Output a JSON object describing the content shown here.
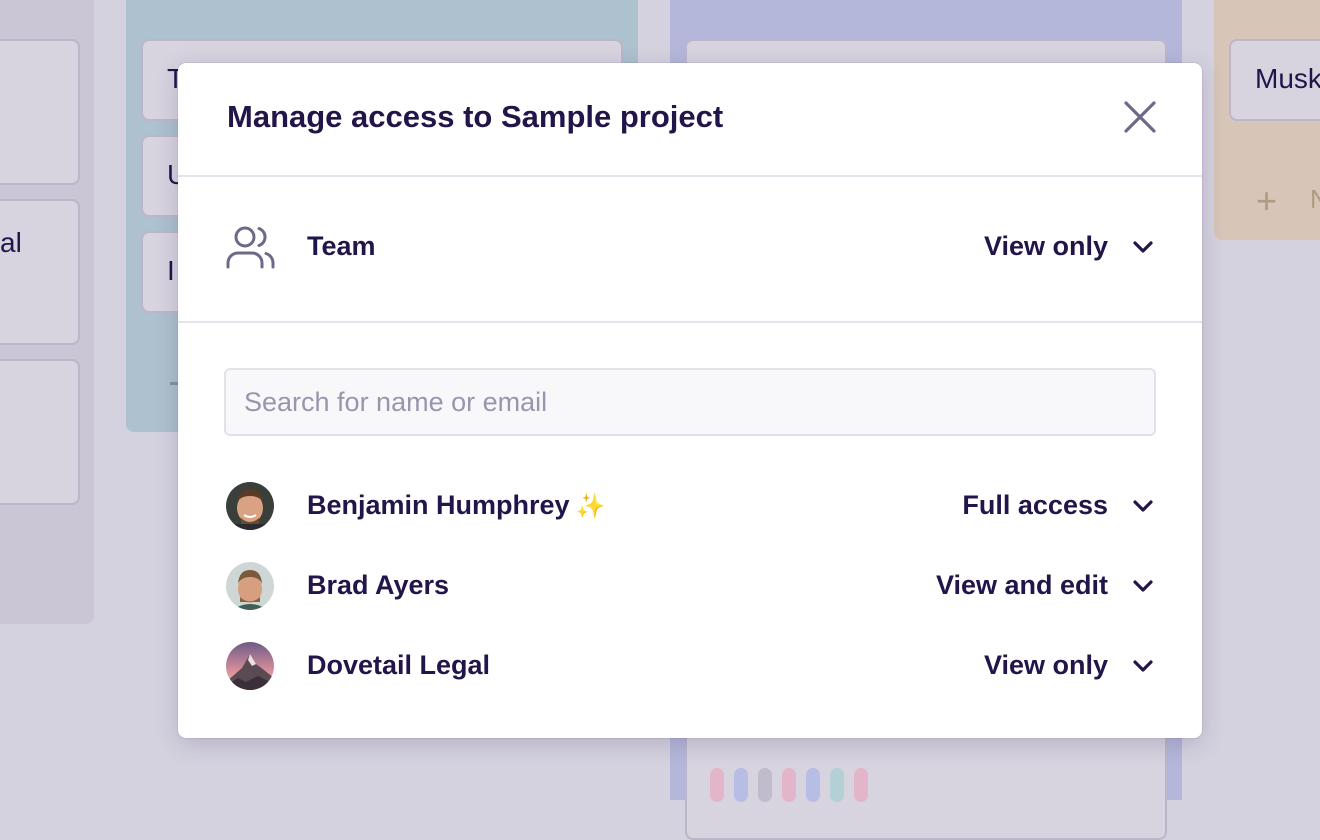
{
  "background": {
    "cards": [
      "T",
      "U",
      "I",
      "al",
      "Musk"
    ],
    "new_label": "N"
  },
  "modal": {
    "title": "Manage access to Sample project",
    "team": {
      "label": "Team",
      "access": "View only"
    },
    "search": {
      "placeholder": "Search for name or email",
      "value": ""
    },
    "members": [
      {
        "name": "Benjamin Humphrey",
        "badge": "✨",
        "access": "Full access"
      },
      {
        "name": "Brad Ayers",
        "badge": "",
        "access": "View and edit"
      },
      {
        "name": "Dovetail Legal",
        "badge": "",
        "access": "View only"
      }
    ]
  },
  "colors": {
    "text": "#22154a",
    "muted_icon": "#6f6888",
    "column_teal": "#adc1ce",
    "column_violet": "#b5b7da",
    "column_tan": "#d7c5b8"
  },
  "icons": {
    "close": "close-icon",
    "team": "team-icon",
    "dropdown": "chevron-down-icon"
  }
}
